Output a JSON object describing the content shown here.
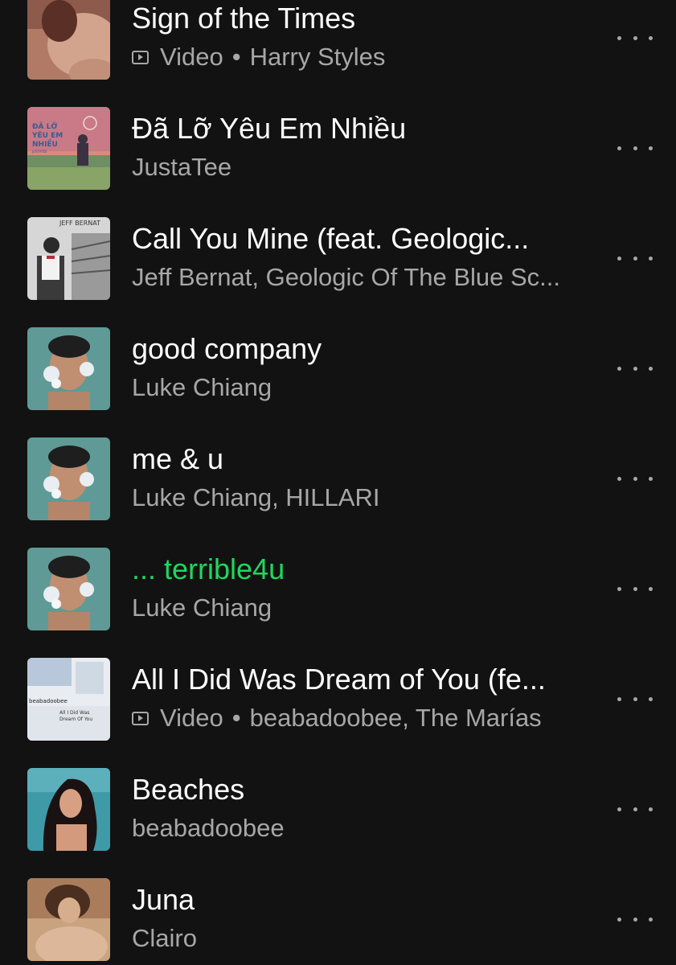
{
  "tracks": [
    {
      "title": "Sign of the Times",
      "is_video": true,
      "video_label": "Video",
      "separator": "•",
      "artists": "Harry Styles",
      "playing": false
    },
    {
      "title": "Đã Lỡ Yêu Em Nhiều",
      "is_video": false,
      "artists": "JustaTee",
      "playing": false,
      "cover_text": [
        "ĐÃ LỠ",
        "YÊU EM",
        "NHIỀU",
        "JUSTATEE"
      ]
    },
    {
      "title": "Call You Mine (feat. Geologic...",
      "is_video": false,
      "artists": "Jeff Bernat, Geologic Of The Blue Sc...",
      "playing": false,
      "cover_text": [
        "JEFF BERNAT"
      ]
    },
    {
      "title": "good company",
      "is_video": false,
      "artists": "Luke Chiang",
      "playing": false
    },
    {
      "title": "me & u",
      "is_video": false,
      "artists": "Luke Chiang, HILLARI",
      "playing": false
    },
    {
      "title": "... terrible4u",
      "is_video": false,
      "artists": "Luke Chiang",
      "playing": true
    },
    {
      "title": "All I Did Was Dream of You (fe...",
      "is_video": true,
      "video_label": "Video",
      "separator": "•",
      "artists": "beabadoobee, The Marías",
      "playing": false,
      "cover_text": [
        "beabadoobee",
        "All I Did Was",
        "Dream Of You"
      ]
    },
    {
      "title": "Beaches",
      "is_video": false,
      "artists": "beabadoobee",
      "playing": false
    },
    {
      "title": "Juna",
      "is_video": false,
      "artists": "Clairo",
      "playing": false
    }
  ],
  "icons": {
    "more": "more-options-icon",
    "video": "video-icon"
  },
  "colors": {
    "background": "#121212",
    "title": "#ffffff",
    "subtitle": "#a7a7a7",
    "playing": "#1ed760"
  }
}
